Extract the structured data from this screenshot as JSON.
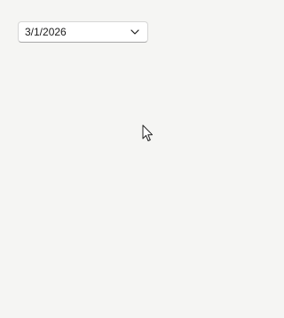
{
  "date_picker": {
    "value": "3/1/2026",
    "dropdown_icon": "chevron-down-icon"
  },
  "pointer": {
    "icon": "mouse-cursor-icon"
  },
  "colors": {
    "background": "#f5f5f3",
    "field_background": "#ffffff",
    "field_border": "#d6d6d6",
    "text": "#1b1b1b"
  }
}
